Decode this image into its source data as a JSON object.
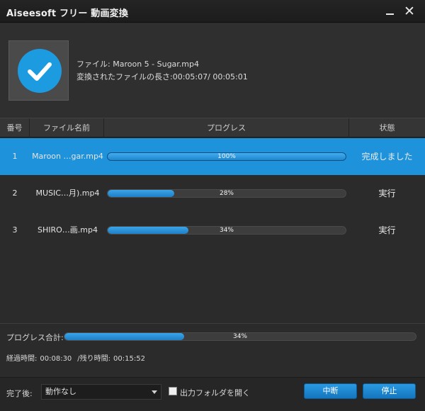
{
  "window": {
    "title": "Aiseesoft フリー 動画変換",
    "minimize_glyph": "",
    "close_glyph": "✕"
  },
  "info": {
    "file_label": "ファイル:",
    "file_name": "Maroon 5 - Sugar.mp4",
    "length_label": "変換されたファイルの長さ:",
    "length_value": "00:05:07/ 00:05:01"
  },
  "table": {
    "headers": {
      "no": "番号",
      "name": "ファイル名前",
      "progress": "プログレス",
      "status": "状態"
    },
    "rows": [
      {
        "no": "1",
        "name": "Maroon …gar.mp4",
        "progress": 1.0,
        "progress_text": "100%",
        "status": "完成しました",
        "selected": true
      },
      {
        "no": "2",
        "name": "MUSIC…月).mp4",
        "progress": 0.28,
        "progress_text": "28%",
        "status": "実行",
        "selected": false
      },
      {
        "no": "3",
        "name": "SHIRO…画.mp4",
        "progress": 0.34,
        "progress_text": "34%",
        "status": "実行",
        "selected": false
      }
    ]
  },
  "total": {
    "label": "プログレス合計:",
    "progress": 0.34,
    "progress_text": "34%",
    "elapsed_label": "経過時間:",
    "elapsed_value": "00:08:30",
    "remaining_label": "/残り時間:",
    "remaining_value": "00:15:52"
  },
  "bottom": {
    "after_label": "完了後:",
    "after_value": "動作なし",
    "open_folder_label": "出力フォルダを開く",
    "open_folder_checked": false,
    "abort_label": "中断",
    "stop_label": "停止"
  },
  "colors": {
    "accent": "#1e93dc",
    "background": "#2b2b2b"
  }
}
